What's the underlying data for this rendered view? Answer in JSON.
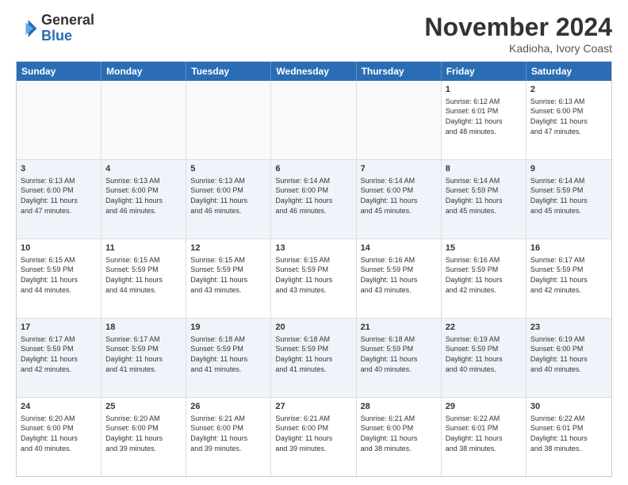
{
  "logo": {
    "line1": "General",
    "line2": "Blue"
  },
  "title": "November 2024",
  "subtitle": "Kadioha, Ivory Coast",
  "days": [
    "Sunday",
    "Monday",
    "Tuesday",
    "Wednesday",
    "Thursday",
    "Friday",
    "Saturday"
  ],
  "rows": [
    [
      {
        "day": "",
        "info": ""
      },
      {
        "day": "",
        "info": ""
      },
      {
        "day": "",
        "info": ""
      },
      {
        "day": "",
        "info": ""
      },
      {
        "day": "",
        "info": ""
      },
      {
        "day": "1",
        "info": "Sunrise: 6:12 AM\nSunset: 6:01 PM\nDaylight: 11 hours\nand 48 minutes."
      },
      {
        "day": "2",
        "info": "Sunrise: 6:13 AM\nSunset: 6:00 PM\nDaylight: 11 hours\nand 47 minutes."
      }
    ],
    [
      {
        "day": "3",
        "info": "Sunrise: 6:13 AM\nSunset: 6:00 PM\nDaylight: 11 hours\nand 47 minutes."
      },
      {
        "day": "4",
        "info": "Sunrise: 6:13 AM\nSunset: 6:00 PM\nDaylight: 11 hours\nand 46 minutes."
      },
      {
        "day": "5",
        "info": "Sunrise: 6:13 AM\nSunset: 6:00 PM\nDaylight: 11 hours\nand 46 minutes."
      },
      {
        "day": "6",
        "info": "Sunrise: 6:14 AM\nSunset: 6:00 PM\nDaylight: 11 hours\nand 46 minutes."
      },
      {
        "day": "7",
        "info": "Sunrise: 6:14 AM\nSunset: 6:00 PM\nDaylight: 11 hours\nand 45 minutes."
      },
      {
        "day": "8",
        "info": "Sunrise: 6:14 AM\nSunset: 5:59 PM\nDaylight: 11 hours\nand 45 minutes."
      },
      {
        "day": "9",
        "info": "Sunrise: 6:14 AM\nSunset: 5:59 PM\nDaylight: 11 hours\nand 45 minutes."
      }
    ],
    [
      {
        "day": "10",
        "info": "Sunrise: 6:15 AM\nSunset: 5:59 PM\nDaylight: 11 hours\nand 44 minutes."
      },
      {
        "day": "11",
        "info": "Sunrise: 6:15 AM\nSunset: 5:59 PM\nDaylight: 11 hours\nand 44 minutes."
      },
      {
        "day": "12",
        "info": "Sunrise: 6:15 AM\nSunset: 5:59 PM\nDaylight: 11 hours\nand 43 minutes."
      },
      {
        "day": "13",
        "info": "Sunrise: 6:15 AM\nSunset: 5:59 PM\nDaylight: 11 hours\nand 43 minutes."
      },
      {
        "day": "14",
        "info": "Sunrise: 6:16 AM\nSunset: 5:59 PM\nDaylight: 11 hours\nand 43 minutes."
      },
      {
        "day": "15",
        "info": "Sunrise: 6:16 AM\nSunset: 5:59 PM\nDaylight: 11 hours\nand 42 minutes."
      },
      {
        "day": "16",
        "info": "Sunrise: 6:17 AM\nSunset: 5:59 PM\nDaylight: 11 hours\nand 42 minutes."
      }
    ],
    [
      {
        "day": "17",
        "info": "Sunrise: 6:17 AM\nSunset: 5:59 PM\nDaylight: 11 hours\nand 42 minutes."
      },
      {
        "day": "18",
        "info": "Sunrise: 6:17 AM\nSunset: 5:59 PM\nDaylight: 11 hours\nand 41 minutes."
      },
      {
        "day": "19",
        "info": "Sunrise: 6:18 AM\nSunset: 5:59 PM\nDaylight: 11 hours\nand 41 minutes."
      },
      {
        "day": "20",
        "info": "Sunrise: 6:18 AM\nSunset: 5:59 PM\nDaylight: 11 hours\nand 41 minutes."
      },
      {
        "day": "21",
        "info": "Sunrise: 6:18 AM\nSunset: 5:59 PM\nDaylight: 11 hours\nand 40 minutes."
      },
      {
        "day": "22",
        "info": "Sunrise: 6:19 AM\nSunset: 5:59 PM\nDaylight: 11 hours\nand 40 minutes."
      },
      {
        "day": "23",
        "info": "Sunrise: 6:19 AM\nSunset: 6:00 PM\nDaylight: 11 hours\nand 40 minutes."
      }
    ],
    [
      {
        "day": "24",
        "info": "Sunrise: 6:20 AM\nSunset: 6:00 PM\nDaylight: 11 hours\nand 40 minutes."
      },
      {
        "day": "25",
        "info": "Sunrise: 6:20 AM\nSunset: 6:00 PM\nDaylight: 11 hours\nand 39 minutes."
      },
      {
        "day": "26",
        "info": "Sunrise: 6:21 AM\nSunset: 6:00 PM\nDaylight: 11 hours\nand 39 minutes."
      },
      {
        "day": "27",
        "info": "Sunrise: 6:21 AM\nSunset: 6:00 PM\nDaylight: 11 hours\nand 39 minutes."
      },
      {
        "day": "28",
        "info": "Sunrise: 6:21 AM\nSunset: 6:00 PM\nDaylight: 11 hours\nand 38 minutes."
      },
      {
        "day": "29",
        "info": "Sunrise: 6:22 AM\nSunset: 6:01 PM\nDaylight: 11 hours\nand 38 minutes."
      },
      {
        "day": "30",
        "info": "Sunrise: 6:22 AM\nSunset: 6:01 PM\nDaylight: 11 hours\nand 38 minutes."
      }
    ]
  ]
}
